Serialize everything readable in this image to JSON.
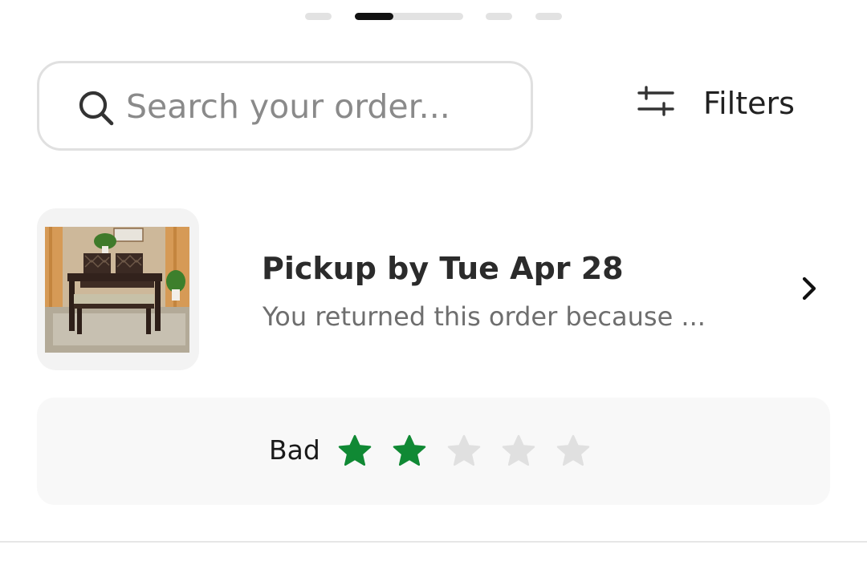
{
  "pager": {
    "active_index": 1,
    "active_progress": 0.35
  },
  "search": {
    "placeholder": "Search your order...",
    "value": ""
  },
  "filters": {
    "label": "Filters",
    "icon": "sliders-icon"
  },
  "order": {
    "title": "Pickup by Tue Apr 28",
    "subtitle": "You returned this order because ...",
    "thumbnail": "dining-table-set-image",
    "chevron_icon": "chevron-right-icon"
  },
  "rating": {
    "label": "Bad",
    "value": 2,
    "max": 5,
    "filled_color": "#108934",
    "empty_color": "#e0e0e0"
  },
  "colors": {
    "accent_green": "#108934",
    "border": "#e0e0e0",
    "card_bg": "#f8f8f8"
  }
}
